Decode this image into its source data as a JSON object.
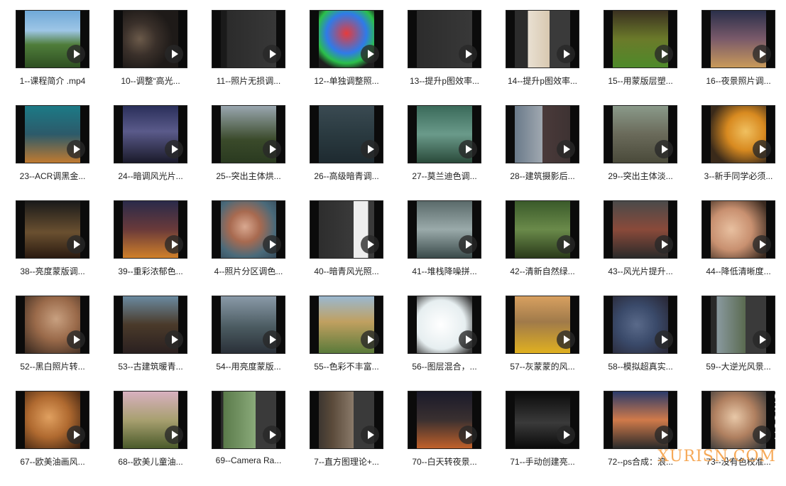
{
  "items": [
    {
      "label": "1--课程简介 .mp4",
      "art": "linear-gradient(180deg,#6fa8d8 0%,#9ec6e6 35%,#4f7d3a 60%,#2e4f22 100%)"
    },
    {
      "label": "10--调整“高光...",
      "art": "radial-gradient(circle at 35% 50%,#6b5a4a 0,#3a302a 30%,#1e1a18 60%),linear-gradient(90deg,#2a2522,#3b3b3b)"
    },
    {
      "label": "11--照片无损调...",
      "art": "linear-gradient(90deg,#1a1a1a 0,#1a1a1a 20%,#2b2b2b 20%,#3a3a3a 100%)"
    },
    {
      "label": "12--单独调整照...",
      "art": "radial-gradient(circle at 50% 40%,#e63b3b 0,#2f7be8 40%,#2bbf4a 60%,#1e1e1e 75%)"
    },
    {
      "label": "13--提升p图效率...",
      "art": "linear-gradient(90deg,#2a2a2a,#3a3a3a)"
    },
    {
      "label": "14--提升p图效率...",
      "art": "linear-gradient(90deg,#2c2c2c 0,#2c2c2c 30%,#e9e0d2 30%,#d8c8b0 60%,#3a3a3a 60%)"
    },
    {
      "label": "15--用蒙版层塑...",
      "art": "linear-gradient(180deg,#3a3020 0%,#6b7a2a 50%,#4e8a2a 100%)"
    },
    {
      "label": "16--夜景照片调...",
      "art": "linear-gradient(180deg,#2a2f4a 0%,#7a5a6a 50%,#c99a5a 100%)"
    },
    {
      "label": "23--ACR调黑金...",
      "art": "linear-gradient(180deg,#1c7a86 0%,#2c5a6a 50%,#c07a30 100%)"
    },
    {
      "label": "24--暗调风光片...",
      "art": "linear-gradient(180deg,#2a2f5a 0%,#5a5a8a 45%,#1a1a2a 100%)"
    },
    {
      "label": "25--突出主体烘...",
      "art": "linear-gradient(180deg,#9aa7b0 0%,#3a4a2a 60%,#2a3a20 100%)"
    },
    {
      "label": "26--高级暗青调...",
      "art": "linear-gradient(180deg,#3a4a52 0%,#2a3a40 50%,#1e2a30 100%)"
    },
    {
      "label": "27--莫兰迪色调...",
      "art": "linear-gradient(180deg,#3a6a5a 0%,#6a9a8a 50%,#2a4a3a 100%)"
    },
    {
      "label": "28--建筑摄影后...",
      "art": "linear-gradient(90deg,#1a1a1a 0,#1a1a1a 12%,#6a7a8a 12%,#a0a8b0 50%,#4a3a3a 50%,#3a3030 100%)"
    },
    {
      "label": "29--突出主体淡...",
      "art": "linear-gradient(180deg,#8a9a8a 0%,#6a6a5a 50%,#4a4a3a 100%)"
    },
    {
      "label": "3--新手同学必须...",
      "art": "radial-gradient(circle at 60% 45%,#f0c060 0,#d88a20 35%,#3a2a1a 70%)"
    },
    {
      "label": "38--亮度蒙版调...",
      "art": "linear-gradient(180deg,#1a1a1a 0%,#6a5030 55%,#2a1a10 100%)"
    },
    {
      "label": "39--重彩浓郁色...",
      "art": "linear-gradient(180deg,#2a2a4a 0%,#6a3a3a 50%,#d0802a 100%)"
    },
    {
      "label": "4--照片分区调色...",
      "art": "radial-gradient(circle at 45% 45%,#d9a890 0,#a86a50 30%,#4a6a7a 60%,#2a3a4a 100%)"
    },
    {
      "label": "40--暗青风光照...",
      "art": "linear-gradient(90deg,#2a2a2a 0,#3a3a3a 60%,#eeeeee 60%,#eeeeee 80%,#3a3a3a 80%)"
    },
    {
      "label": "41--堆栈降噪拼...",
      "art": "linear-gradient(180deg,#5a6a6a 0%,#9aaaaa 50%,#3a4a4a 100%)"
    },
    {
      "label": "42--清新自然绿...",
      "art": "linear-gradient(180deg,#3a5a2a 0%,#6a8a4a 50%,#2a3a1a 100%)"
    },
    {
      "label": "43--风光片提升...",
      "art": "linear-gradient(180deg,#4a4a4a 0%,#8a4a3a 50%,#2a2a2a 100%)"
    },
    {
      "label": "44--降低清晰度...",
      "art": "radial-gradient(circle at 40% 50%,#e8c0a0 0,#c89070 40%,#3a2a20 80%)"
    },
    {
      "label": "52--黑白照片转...",
      "art": "radial-gradient(circle at 55% 40%,#c8a080 0,#9a6a4a 40%,#3a2a20 85%)"
    },
    {
      "label": "53--古建筑暖青...",
      "art": "linear-gradient(180deg,#6a8aa0 0%,#4a3a2a 50%,#2a2020 100%)"
    },
    {
      "label": "54--用亮度蒙版...",
      "art": "linear-gradient(180deg,#8a9aa8 0%,#4a5a60 55%,#2a3038 100%)"
    },
    {
      "label": "55--色彩不丰富...",
      "art": "linear-gradient(180deg,#9ab8d0 0%,#c0a060 45%,#5a7a3a 100%)"
    },
    {
      "label": "56--图层混合，...",
      "art": "radial-gradient(circle at 45% 50%,#ffffff 0,#e6eef0 50%,#3a3a3a 80%)"
    },
    {
      "label": "57--灰蒙蒙的风...",
      "art": "linear-gradient(180deg,#d8a060 0%,#a07a4a 45%,#e0b020 100%)"
    },
    {
      "label": "58--模拟超真实...",
      "art": "radial-gradient(circle at 45% 50%,#5a6a8a 0,#3a4a6a 40%,#2a2a3a 80%)"
    },
    {
      "label": "59--大逆光风景...",
      "art": "linear-gradient(90deg,#2a2a2a 0,#2a2a2a 20%,#8a9aa0 20%,#5a6a50 60%,#3a3a3a 60%)"
    },
    {
      "label": "67--欧美油画风...",
      "art": "radial-gradient(circle at 45% 45%,#e0a060 0,#b06a30 40%,#3a2010 85%)"
    },
    {
      "label": "68--欧美儿童油...",
      "art": "linear-gradient(180deg,#d8b0c0 0%,#a8a070 50%,#4a5a2a 100%)"
    },
    {
      "label": "69--Camera Ra...",
      "art": "linear-gradient(90deg,#2a2a2a 0,#2a2a2a 15%,#5a7a4a 15%,#8aaa7a 60%,#3a3a3a 60%)"
    },
    {
      "label": "7--直方图理论+...",
      "art": "linear-gradient(90deg,#2a2a2a 0,#5a4a3a 30%,#8a7a6a 60%,#3a3a3a 60%)"
    },
    {
      "label": "70--白天转夜景...",
      "art": "linear-gradient(180deg,#1a1a2a 0%,#3a3030 50%,#c0602a 100%)"
    },
    {
      "label": "71--手动创建亮...",
      "art": "linear-gradient(180deg,#0a0a0a 0%,#3a3a3a 55%,#0a0a0a 100%)"
    },
    {
      "label": "72--ps合成：浪...",
      "art": "linear-gradient(180deg,#2a3a6a 0%,#d07a4a 50%,#2a2a2a 100%)"
    },
    {
      "label": "73--没有色校准...",
      "art": "radial-gradient(circle at 45% 45%,#e8c8a8 0,#b08060 40%,#3a3a3a 80%)"
    }
  ],
  "watermark": "XURISN.COM",
  "side_watermark": "ISN.COM"
}
